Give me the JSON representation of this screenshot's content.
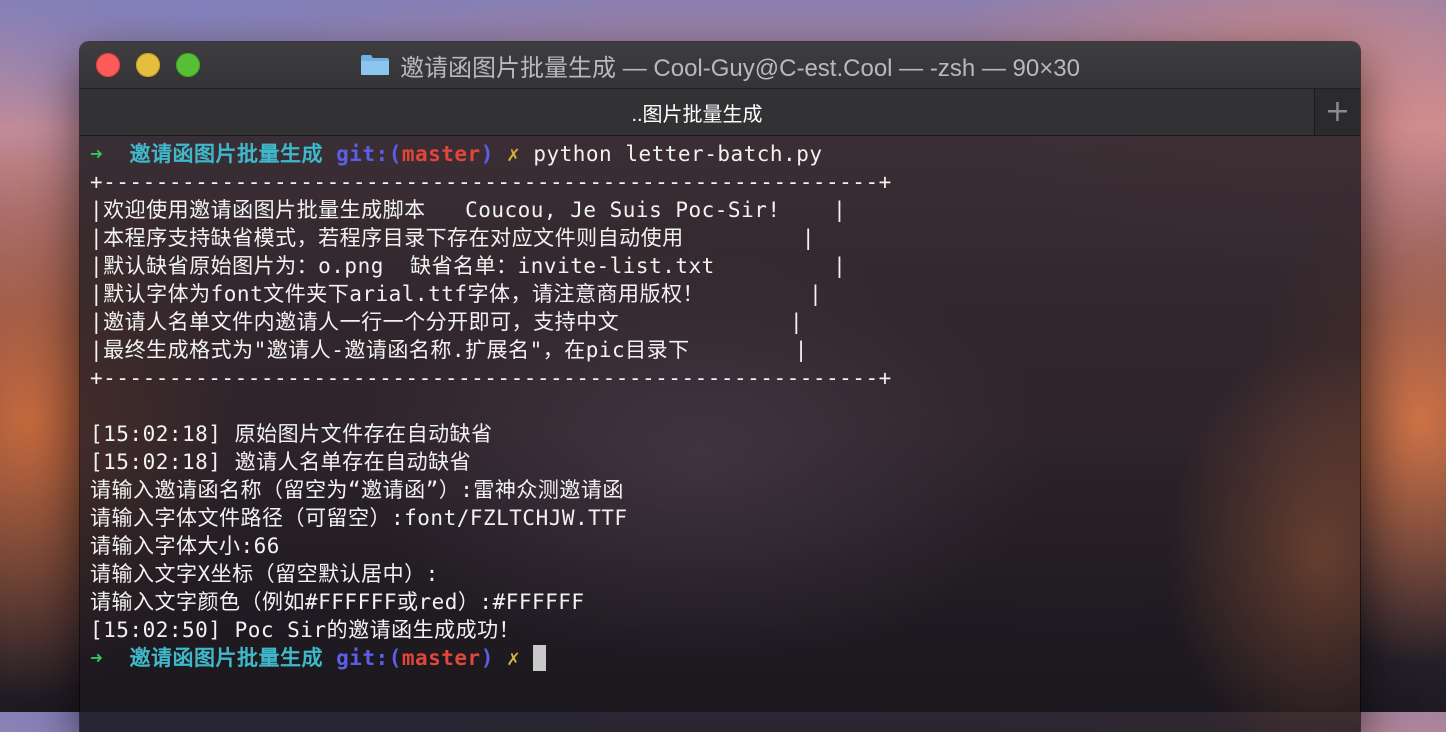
{
  "window": {
    "title": "邀请函图片批量生成 — Cool-Guy@C-est.Cool — -zsh — 90×30",
    "tab_title": "..图片批量生成",
    "new_tab_label": "+",
    "icons": {
      "title_icon": "folder-icon",
      "new_tab_icon": "plus-icon"
    }
  },
  "prompt": {
    "arrow": "➜",
    "dir": "邀请函图片批量生成",
    "git_prefix": "git:",
    "paren_open": "(",
    "branch": "master",
    "paren_close": ")",
    "dirty_marker": "✗",
    "command": "python letter-batch.py"
  },
  "banner": {
    "border": "+-----------------------------------------------------------+",
    "lines": [
      "|欢迎使用邀请函图片批量生成脚本   Coucou, Je Suis Poc-Sir!    |",
      "|本程序支持缺省模式，若程序目录下存在对应文件则自动使用         |",
      "|默认缺省原始图片为：o.png  缺省名单：invite-list.txt         |",
      "|默认字体为font文件夹下arial.ttf字体，请注意商用版权！        |",
      "|邀请人名单文件内邀请人一行一个分开即可，支持中文             |",
      "|最终生成格式为\"邀请人-邀请函名称.扩展名\"，在pic目录下        |"
    ]
  },
  "output_lines": [
    "[15:02:18] 原始图片文件存在自动缺省",
    "[15:02:18] 邀请人名单存在自动缺省",
    "请输入邀请函名称（留空为“邀请函”）:雷神众测邀请函",
    "请输入字体文件路径（可留空）:font/FZLTCHJW.TTF",
    "请输入字体大小:66",
    "请输入文字X坐标（留空默认居中）:",
    "请输入文字颜色（例如#FFFFFF或red）:#FFFFFF",
    "[15:02:50] Poc Sir的邀请函生成成功！"
  ],
  "colors": {
    "arrow": "#35c25f",
    "dir": "#3fb8c9",
    "git": "#5c5fe6",
    "branch": "#e0463a",
    "dirty": "#d1b23a",
    "close": "#fc5b57",
    "minimize": "#e5bf3c",
    "maximize": "#57c038"
  }
}
